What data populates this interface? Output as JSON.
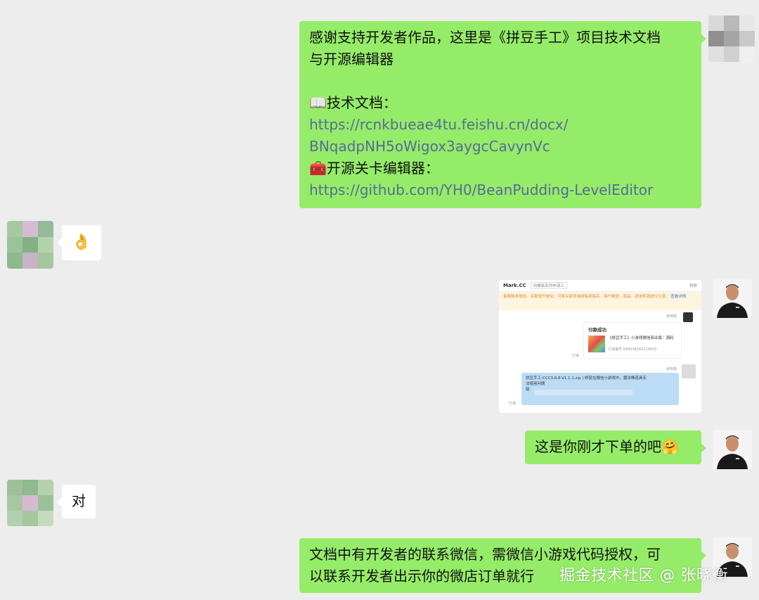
{
  "top_fade_text": "…",
  "messages": {
    "m1": {
      "lines": [
        "感谢支持开发者作品，这里是《拼豆手工》项目技术文档",
        "与开源编辑器",
        "",
        "📖技术文档：",
        "🧰开源关卡编辑器："
      ],
      "doc_link_line1": "https://rcnkbueae4tu.feishu.cn/docx/",
      "doc_link_line2": "BNqadpNH5oWigox3aygcCavynVc",
      "editor_link": "https://github.com/YH0/BeanPudding-LevelEditor"
    },
    "m2": {
      "text": "👌"
    },
    "m3_screenshot": {
      "shop_name": "Mark.CC",
      "tag": "向模板系列申请工",
      "action": "转移",
      "notice": "客服降本提效、买家提升体验：可将买家咨询按售前售后、客户群体、商品、咨询来源进行分流。",
      "notice_more": "查看详情",
      "sender_label": "张晓衡",
      "pay_title": "付款成功",
      "pay_desc": "《拼豆手工》小游戏微信商业版｜源码",
      "pay_order": "订单编号 6480382642249​19",
      "read_label": "已读",
      "file_line1": "拼豆手工-CCC3.8.8-V1.1.1.zip | 修复在微信小游戏中，魔法棒道具无",
      "file_line2": "法使用问题",
      "file_line3": "链"
    },
    "m4": {
      "text": "这是你刚才下单的吧🤗"
    },
    "m5": {
      "text": "对"
    },
    "m6": {
      "line1": "文档中有开发者的联系微信，需微信小游戏代码授权，可",
      "line2": "以联系开发者出示你的微店订单就行"
    }
  },
  "watermark": "掘金技术社区 @ 张晓衡",
  "colors": {
    "background": "#ededed",
    "bubble_right": "#95ec69",
    "bubble_left": "#ffffff",
    "link": "#576b95"
  }
}
